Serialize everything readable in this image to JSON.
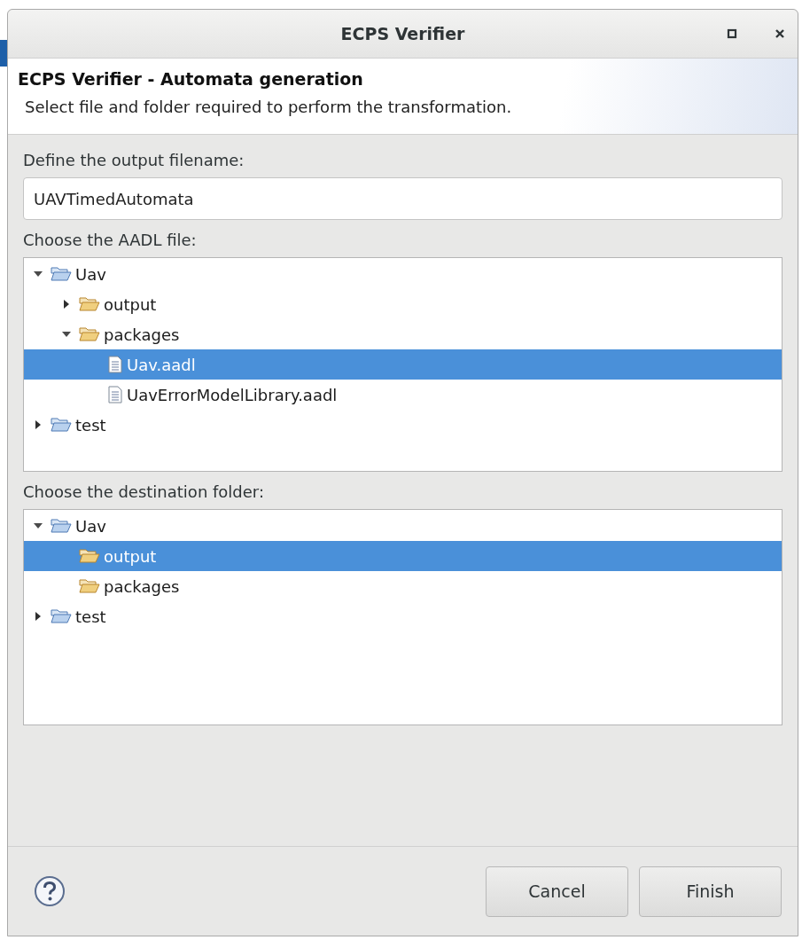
{
  "window": {
    "title": "ECPS Verifier"
  },
  "header": {
    "title": "ECPS Verifier - Automata generation",
    "description": "Select file and folder required to perform the transformation."
  },
  "output_filename": {
    "label": "Define the output filename:",
    "value": "UAVTimedAutomata"
  },
  "aadl_tree": {
    "label": "Choose the AADL file:",
    "items": [
      {
        "label": "Uav",
        "kind": "folder",
        "expandable": true,
        "expanded": true,
        "selected": false,
        "children": [
          {
            "label": "output",
            "kind": "folder",
            "expandable": true,
            "expanded": false,
            "selected": false
          },
          {
            "label": "packages",
            "kind": "folder",
            "expandable": true,
            "expanded": true,
            "selected": false,
            "children": [
              {
                "label": "Uav.aadl",
                "kind": "file",
                "expandable": false,
                "selected": true
              },
              {
                "label": "UavErrorModelLibrary.aadl",
                "kind": "file",
                "expandable": false,
                "selected": false
              }
            ]
          }
        ]
      },
      {
        "label": "test",
        "kind": "folder",
        "expandable": true,
        "expanded": false,
        "selected": false
      }
    ]
  },
  "destination_tree": {
    "label": "Choose the destination folder:",
    "items": [
      {
        "label": "Uav",
        "kind": "folder",
        "expandable": true,
        "expanded": true,
        "selected": false,
        "children": [
          {
            "label": "output",
            "kind": "folder",
            "expandable": false,
            "selected": true
          },
          {
            "label": "packages",
            "kind": "folder",
            "expandable": false,
            "selected": false
          }
        ]
      },
      {
        "label": "test",
        "kind": "folder",
        "expandable": true,
        "expanded": false,
        "selected": false
      }
    ]
  },
  "buttons": [
    {
      "label": "Cancel"
    },
    {
      "label": "Finish"
    }
  ]
}
